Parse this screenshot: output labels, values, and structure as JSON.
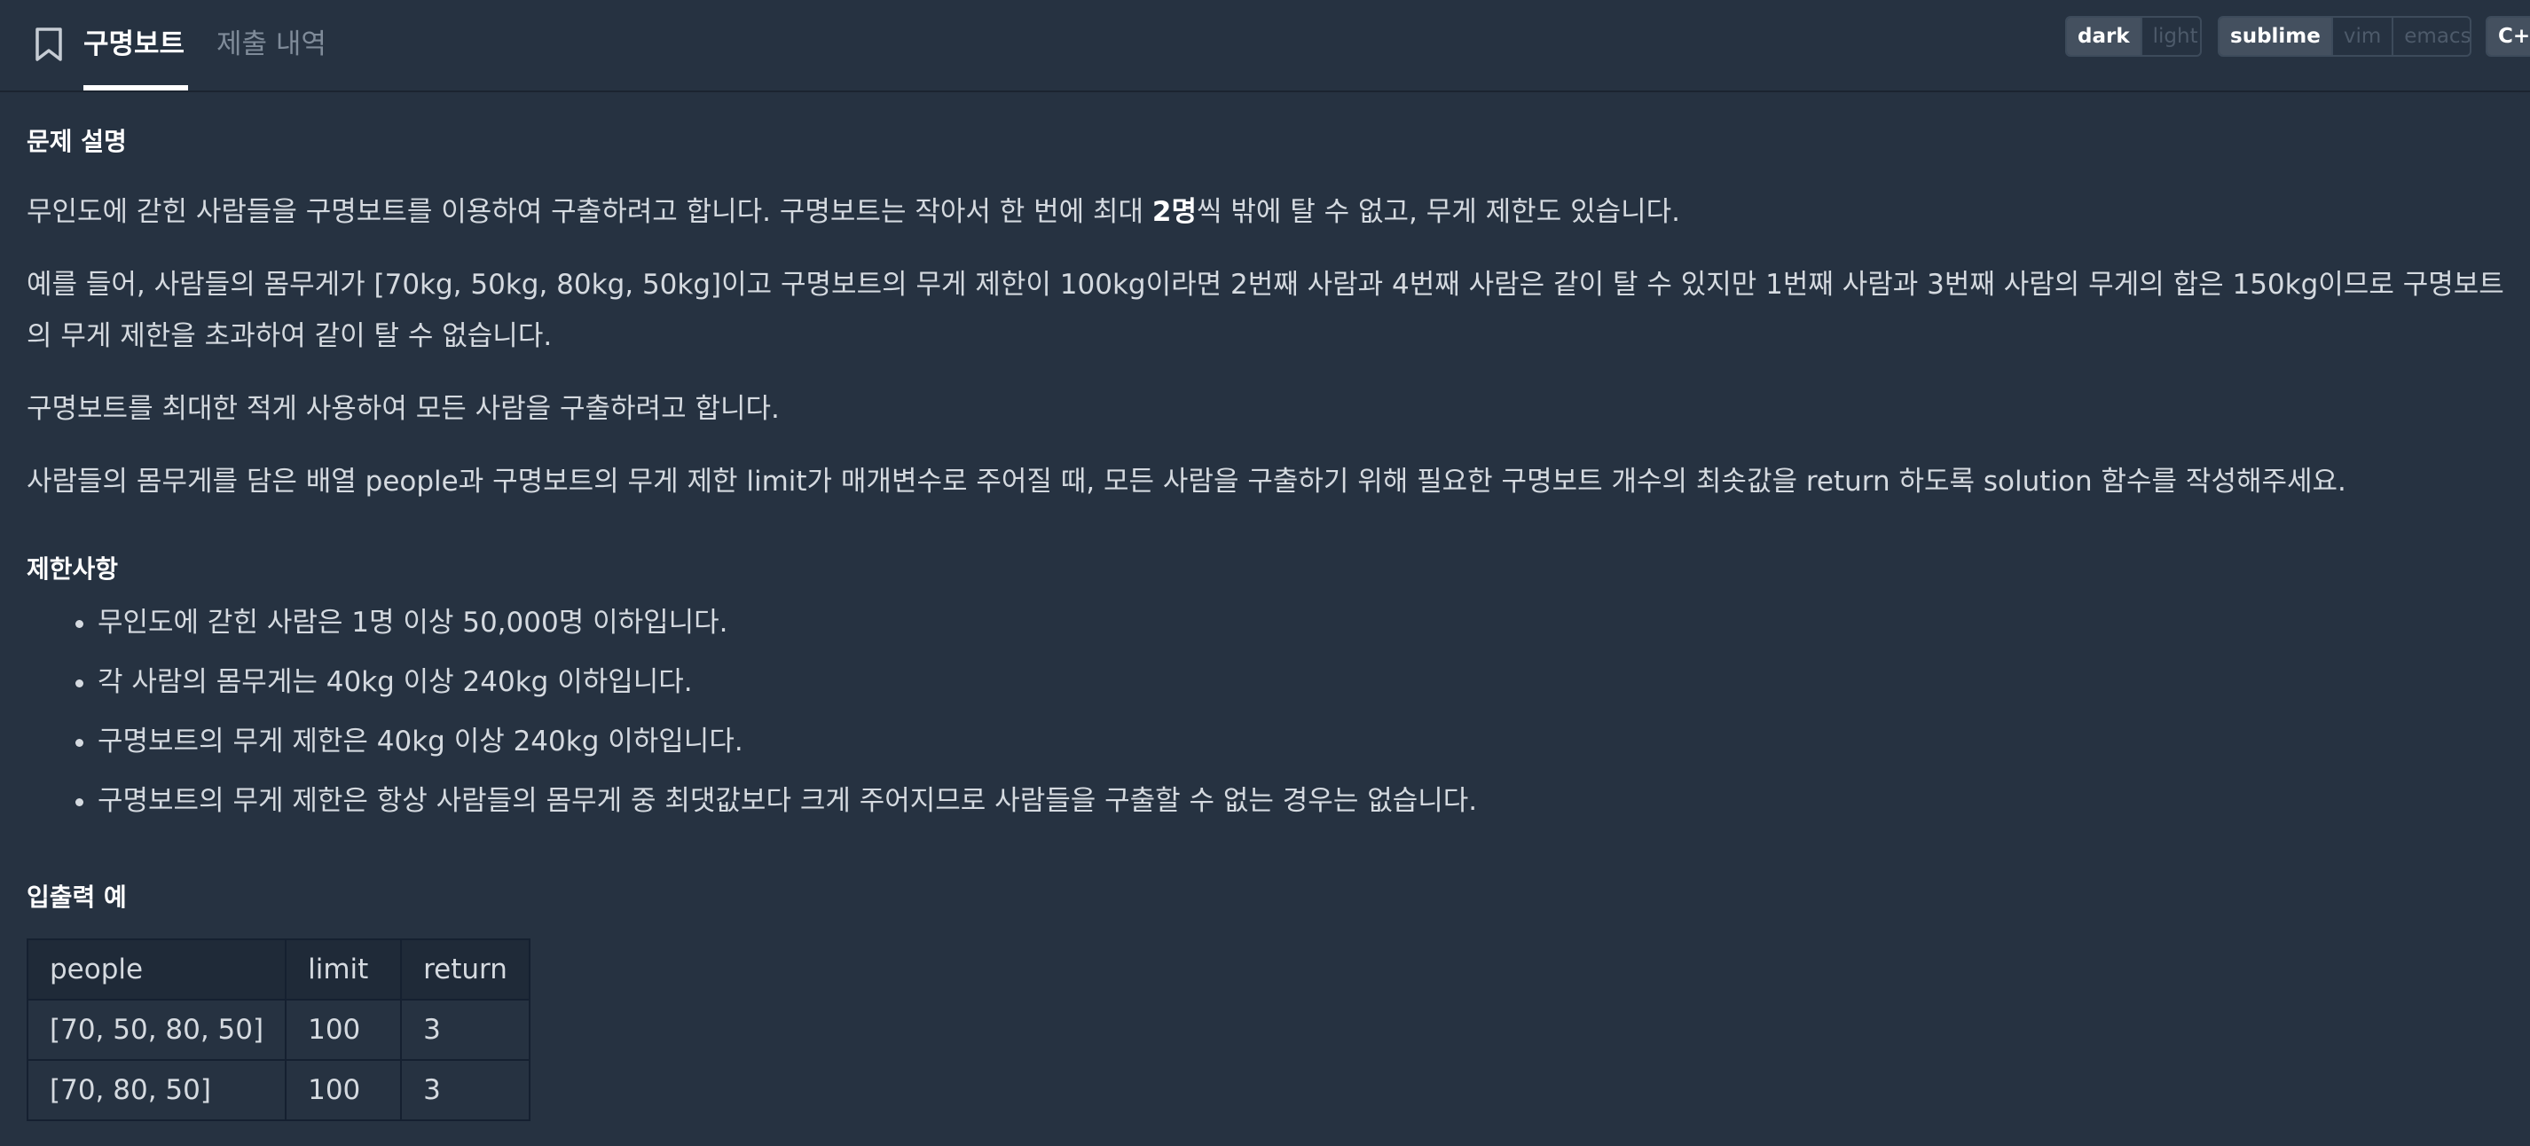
{
  "tabs": {
    "active": "구명보트",
    "inactive": "제출 내역"
  },
  "theme_toggle": {
    "options": [
      "dark",
      "light"
    ],
    "selected": "dark"
  },
  "keymap_toggle": {
    "options": [
      "sublime",
      "vim",
      "emacs"
    ],
    "selected": "sublime"
  },
  "language_toggle": {
    "label": "C+"
  },
  "problem": {
    "heading": "문제 설명",
    "p1_before": "무인도에 갇힌 사람들을 구명보트를 이용하여 구출하려고 합니다. 구명보트는 작아서 한 번에 최대 ",
    "p1_bold": "2명",
    "p1_after": "씩 밖에 탈 수 없고, 무게 제한도 있습니다.",
    "p2": "예를 들어, 사람들의 몸무게가 [70kg, 50kg, 80kg, 50kg]이고 구명보트의 무게 제한이 100kg이라면 2번째 사람과 4번째 사람은 같이 탈 수 있지만 1번째 사람과 3번째 사람의 무게의 합은 150kg이므로 구명보트의 무게 제한을 초과하여 같이 탈 수 없습니다.",
    "p3": "구명보트를 최대한 적게 사용하여 모든 사람을 구출하려고 합니다.",
    "p4": "사람들의 몸무게를 담은 배열 people과 구명보트의 무게 제한 limit가 매개변수로 주어질 때, 모든 사람을 구출하기 위해 필요한 구명보트 개수의 최솟값을 return 하도록 solution 함수를 작성해주세요."
  },
  "constraints": {
    "heading": "제한사항",
    "items": [
      "무인도에 갇힌 사람은 1명 이상 50,000명 이하입니다.",
      "각 사람의 몸무게는 40kg 이상 240kg 이하입니다.",
      "구명보트의 무게 제한은 40kg 이상 240kg 이하입니다.",
      "구명보트의 무게 제한은 항상 사람들의 몸무게 중 최댓값보다 크게 주어지므로 사람들을 구출할 수 없는 경우는 없습니다."
    ]
  },
  "examples": {
    "heading": "입출력 예",
    "headers": [
      "people",
      "limit",
      "return"
    ],
    "rows": [
      [
        "[70, 50, 80, 50]",
        "100",
        "3"
      ],
      [
        "[70, 80, 50]",
        "100",
        "3"
      ]
    ]
  }
}
